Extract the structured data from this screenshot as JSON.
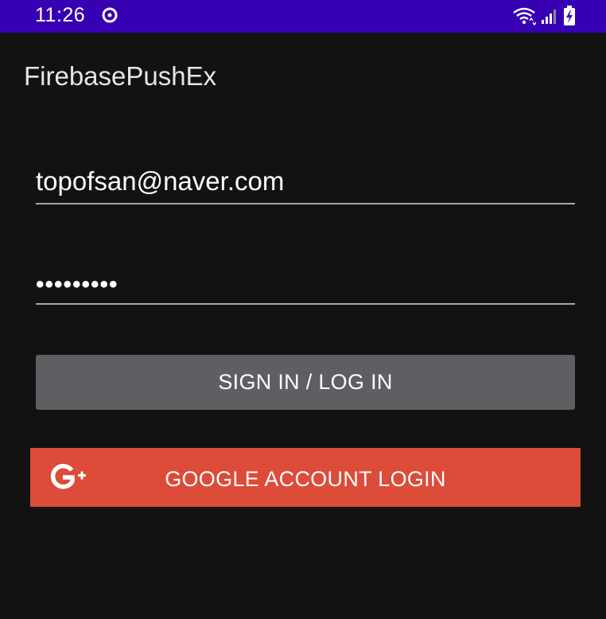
{
  "status_bar": {
    "time": "11:26",
    "icons": [
      "sync-icon",
      "wifi-icon",
      "signal-icon",
      "battery-charging-icon"
    ]
  },
  "app_bar": {
    "title": "FirebasePushEx"
  },
  "form": {
    "email_value": "topofsan@naver.com",
    "password_value": "•••••••••",
    "signin_label": "SIGN IN / LOG IN",
    "google_label": "GOOGLE ACCOUNT LOGIN"
  },
  "colors": {
    "status_bar": "#3700b3",
    "background": "#121212",
    "signin_button": "#5f5f63",
    "google_button": "#dd4b39"
  }
}
